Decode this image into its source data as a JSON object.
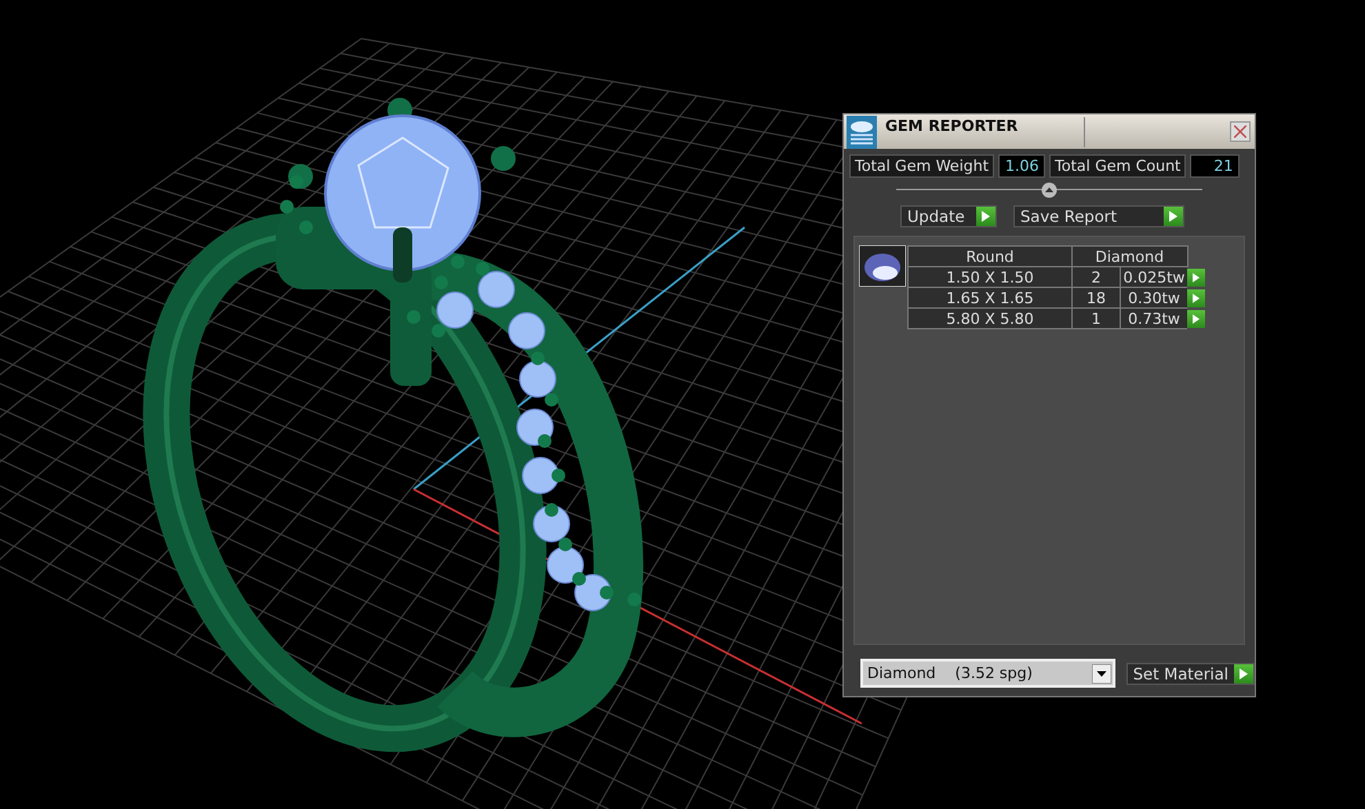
{
  "panel": {
    "title": "GEM REPORTER",
    "total_weight": {
      "label": "Total Gem Weight",
      "value": "1.06"
    },
    "total_count": {
      "label": "Total Gem Count",
      "value": "21"
    },
    "buttons": [
      "Update",
      "Save Report"
    ],
    "table": {
      "columns": [
        "Round",
        "Diamond"
      ],
      "rows": [
        {
          "size": "1.50 X 1.50",
          "count": "2",
          "weight": "0.025tw"
        },
        {
          "size": "1.65 X 1.65",
          "count": "18",
          "weight": "0.30tw"
        },
        {
          "size": "5.80 X 5.80",
          "count": "1",
          "weight": "0.73tw"
        }
      ]
    },
    "material": {
      "value": "Diamond    (3.52 spg)"
    },
    "set_button": "Set Material"
  }
}
